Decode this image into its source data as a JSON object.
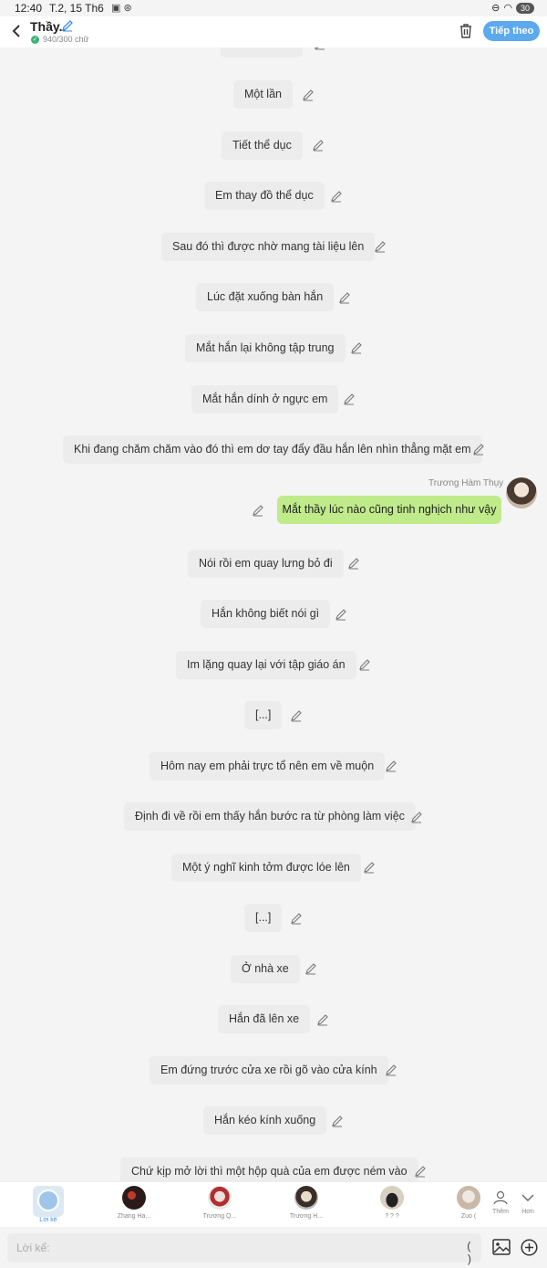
{
  "status": {
    "time": "12:40",
    "date": "T.2, 15 Th6",
    "battery": "30"
  },
  "header": {
    "title": "Thầy..",
    "counter": "940/300 chữ",
    "next_label": "Tiếp theo"
  },
  "messages": [
    {
      "text": "Khóc lần rồi"
    },
    {
      "text": "Một lần"
    },
    {
      "text": "Tiết thể dục"
    },
    {
      "text": "Em thay đồ thể dục"
    },
    {
      "text": "Sau đó thì được nhờ mang tài liệu lên"
    },
    {
      "text": "Lúc đặt xuống bàn hắn"
    },
    {
      "text": "Mắt hắn lại không tập trung"
    },
    {
      "text": "Mắt hắn dính ở ngực em"
    },
    {
      "text": "Khi đang chăm chăm vào đó thì em dơ tay đẩy đầu hắn lên nhìn thẳng mặt em"
    },
    {
      "text": "Nói rồi em quay lưng bỏ đi"
    },
    {
      "text": "Hắn không biết nói gì"
    },
    {
      "text": "Im lặng quay lại với tập giáo án"
    },
    {
      "text": "[...]"
    },
    {
      "text": "Hôm nay em phải trực tổ nên em về muộn"
    },
    {
      "text": "Định đi về rồi em thấy hắn bước ra từ phòng làm việc"
    },
    {
      "text": "Một ý nghĩ kinh tởm được lóe lên"
    },
    {
      "text": "[...]"
    },
    {
      "text": "Ở nhà xe"
    },
    {
      "text": "Hắn đã lên xe"
    },
    {
      "text": "Em đứng trước cửa xe rồi gõ vào cửa kính"
    },
    {
      "text": "Hắn kéo kính xuống"
    },
    {
      "text": "Chứ kịp mở lời thì một hộp quà của em được ném vào"
    }
  ],
  "user_message": {
    "name": "Trương Hàm Thụy",
    "text": "Mắt thầy lúc nào cũng tinh nghịch như vậy"
  },
  "characters": [
    {
      "name": "Lời kể"
    },
    {
      "name": "Zhang Ha..."
    },
    {
      "name": "Trương Q..."
    },
    {
      "name": "Trương H..."
    },
    {
      "name": "? ? ?"
    },
    {
      "name": "Zuo ("
    }
  ],
  "actions": {
    "more_label": "Thêm",
    "collapse_label": "Hơn"
  },
  "input": {
    "placeholder": "Lời kể:",
    "paren": "( )"
  }
}
